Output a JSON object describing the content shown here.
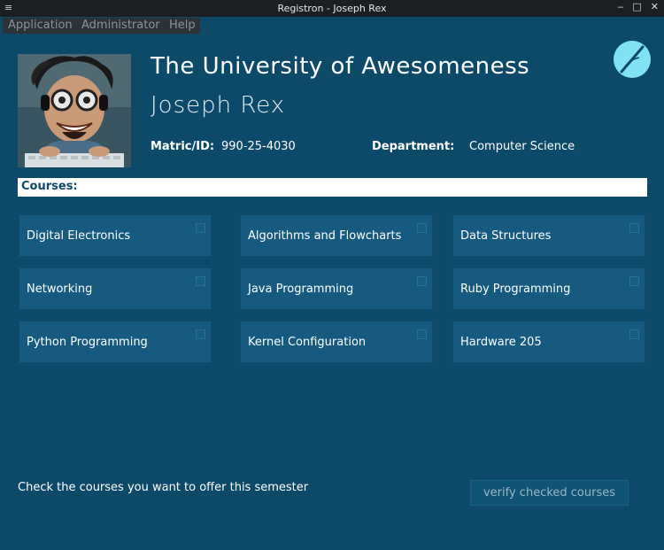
{
  "window": {
    "title": "Registron - Joseph Rex"
  },
  "menubar": {
    "items": [
      "Application",
      "Administrator",
      "Help"
    ]
  },
  "header": {
    "university": "The University of Awesomeness",
    "name": "Joseph Rex",
    "matric_label": "Matric/ID:",
    "matric_value": "990-25-4030",
    "department_label": "Department:",
    "department_value": "Computer Science"
  },
  "courses": {
    "heading": "Courses:",
    "items": [
      "Digital Electronics",
      "Algorithms and Flowcharts",
      "Data Structures",
      "Networking",
      "Java Programming",
      "Ruby Programming",
      "Python Programming",
      "Kernel Configuration",
      "Hardware 205"
    ],
    "checked": [
      false,
      false,
      false,
      false,
      false,
      false,
      false,
      false,
      false
    ]
  },
  "footer": {
    "instruction": "Check the courses you want to offer this semester",
    "verify_label": "verify checked courses"
  },
  "colors": {
    "background": "#0d4a6a",
    "card": "#165a80",
    "logo": "#7fe3f2"
  }
}
